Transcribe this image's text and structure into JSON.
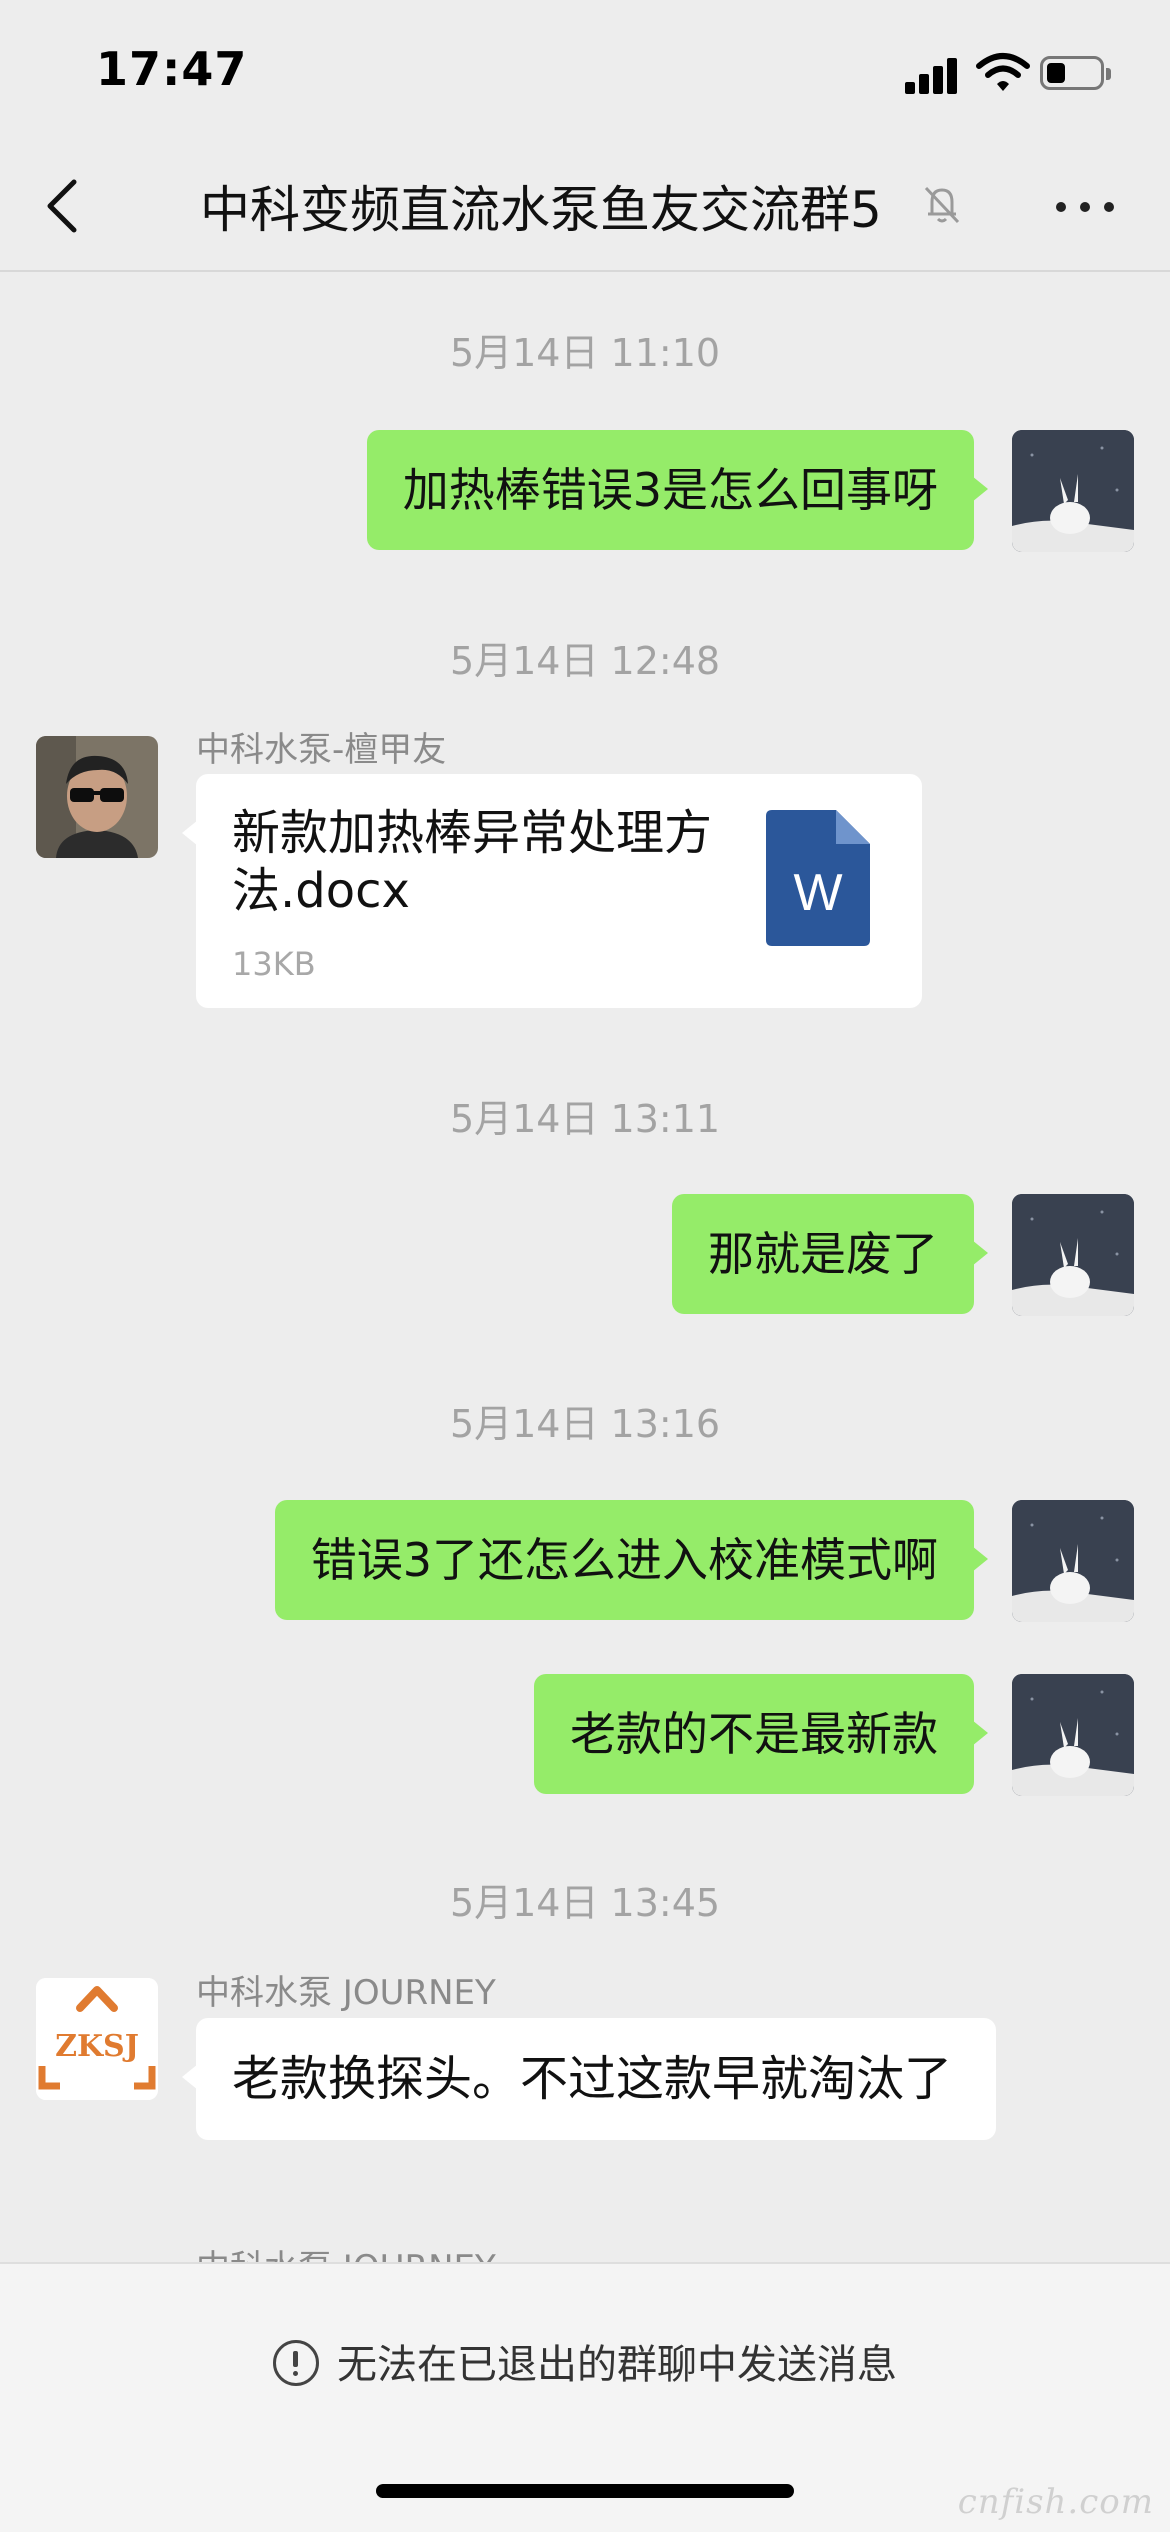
{
  "status_bar": {
    "time": "17:47"
  },
  "nav": {
    "title": "中科变频直流水泵鱼友交流群5"
  },
  "messages": {
    "t1": "5月14日 11:10",
    "m1": "加热棒错误3是怎么回事呀",
    "t2": "5月14日 12:48",
    "sender1": "中科水泵-檀甲友",
    "file_name": "新款加热棒异常处理方法.docx",
    "file_size": "13KB",
    "file_icon_letter": "W",
    "t3": "5月14日 13:11",
    "m2": "那就是废了",
    "t4": "5月14日 13:16",
    "m3": "错误3了还怎么进入校准模式啊",
    "m4": "老款的不是最新款",
    "t5": "5月14日 13:45",
    "sender2": "中科水泵 JOURNEY",
    "zksj_logo_text": "ZKSJ",
    "m5": "老款换探头。不过这款早就淘汰了",
    "partial_sender": "中科水泵 JOURNEY"
  },
  "bottom": {
    "notice": "无法在已退出的群聊中发送消息",
    "watermark": "cnfish.com"
  },
  "colors": {
    "background": "#ededed",
    "outgoing_bubble": "#95ec69",
    "incoming_bubble": "#ffffff",
    "word_blue": "#2b579a",
    "zksj_orange": "#e07b30"
  }
}
